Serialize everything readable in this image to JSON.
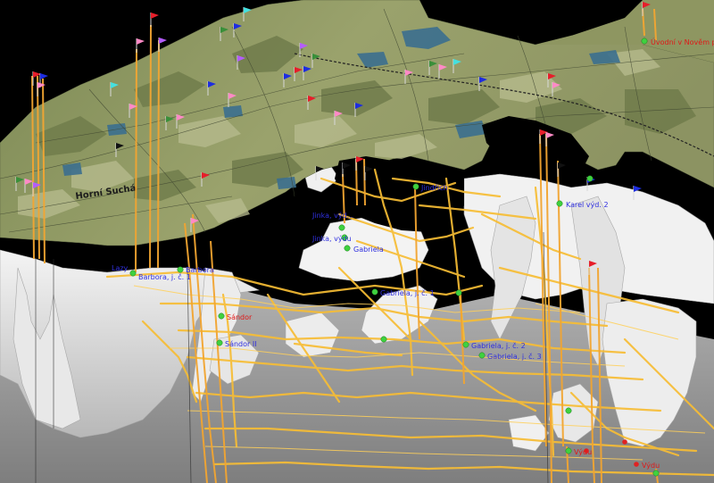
{
  "scene": {
    "colors": {
      "background": "#000000",
      "map_base": "#8f9a62",
      "map_dark": "#6f7a4c",
      "water": "#3b6f8f",
      "terrain": "#d4d4d4",
      "floor": "#9c9c9c",
      "tunnel": "#f7bd35",
      "shaft": "#f2a531",
      "station": "#3fd13f"
    },
    "map_labels": {
      "town_top_right": "Úvodní v Nověm pol",
      "town_left": "Horní Suchá"
    },
    "shaft_labels": {
      "barbora_1": "Barbora, j. č. 1",
      "barbora_2": "Barbora, j. č. 2",
      "barbora_short": "Barbora",
      "lazy": "Lazy",
      "blue_upper": "Jinka, výd...",
      "blue_upper2": "Jinka, výdu",
      "gabriela": "Gabriela",
      "gabriela_j1": "Gabriela, j. č. 1",
      "gabriela_j2": "Gabriela, j. č. 2",
      "gabriela_j3": "Gabriela, j. č. 3",
      "jindrich": "Jindřich",
      "red_a": "Jindřich",
      "red_b": "Sándor",
      "lower_mid": "Sándor II",
      "right_mid": "Karel výd. 2",
      "right_low_a": "Výdu",
      "right_low_b": "Výdu"
    }
  }
}
